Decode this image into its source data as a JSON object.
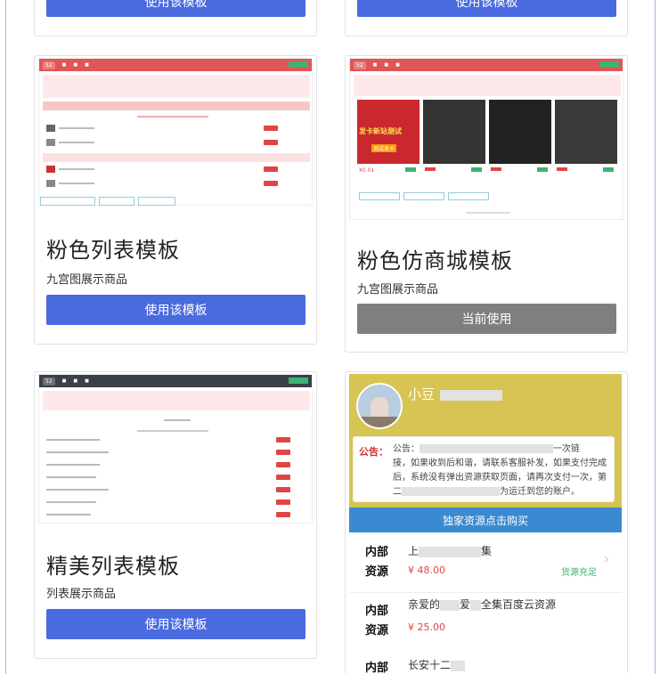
{
  "cards": [
    {
      "button_label": "使用该模板"
    },
    {
      "button_label": "使用该模板"
    },
    {
      "title": "粉色列表模板",
      "desc": "九宫图展示商品",
      "button_label": "使用该模板"
    },
    {
      "title": "粉色仿商城模板",
      "desc": "九宫图展示商品",
      "button_label": "当前使用"
    },
    {
      "title": "精美列表模板",
      "desc": "列表展示商品",
      "button_label": "使用该模板"
    }
  ],
  "preview_profile": {
    "shop_name": "小豆",
    "notice_label": "公告：",
    "notice_prefix": "公告：",
    "notice_suffix": "一次链",
    "notice_lines": [
      "接，如果收到后和谐，请联系客服补发，如果支付完成",
      "后，系统没有弹出资源获取页面，请再次支付一次，第",
      "二"
    ],
    "notice_end": "为运迁到您的账户。",
    "buy_bar": "独家资源点击购买",
    "items": [
      {
        "tag1": "内部",
        "tag2": "资源",
        "name": "上",
        "name_end": "集",
        "price": "¥ 48.00",
        "status": "货源充足"
      },
      {
        "tag1": "内部",
        "tag2": "资源",
        "name": "亲爱的",
        "name_mid": "爱",
        "name_end": "全集百度云资源",
        "price": "¥ 25.00"
      },
      {
        "tag1": "内部",
        "name": "长安十二"
      }
    ]
  },
  "thumb_mall": {
    "product_title": "发卡新站测试",
    "product_title2": "测试发卡",
    "price": "¥0.01"
  },
  "colors": {
    "primary_button": "#4a6ae0",
    "current_button": "#7f7f7f",
    "pink_nav": "#e05555",
    "dark_nav": "#3b3f4a",
    "profile_header": "#d8c452",
    "buy_bar": "#3a8ad1",
    "price_red": "#e04545",
    "stock_green": "#3cb371"
  }
}
